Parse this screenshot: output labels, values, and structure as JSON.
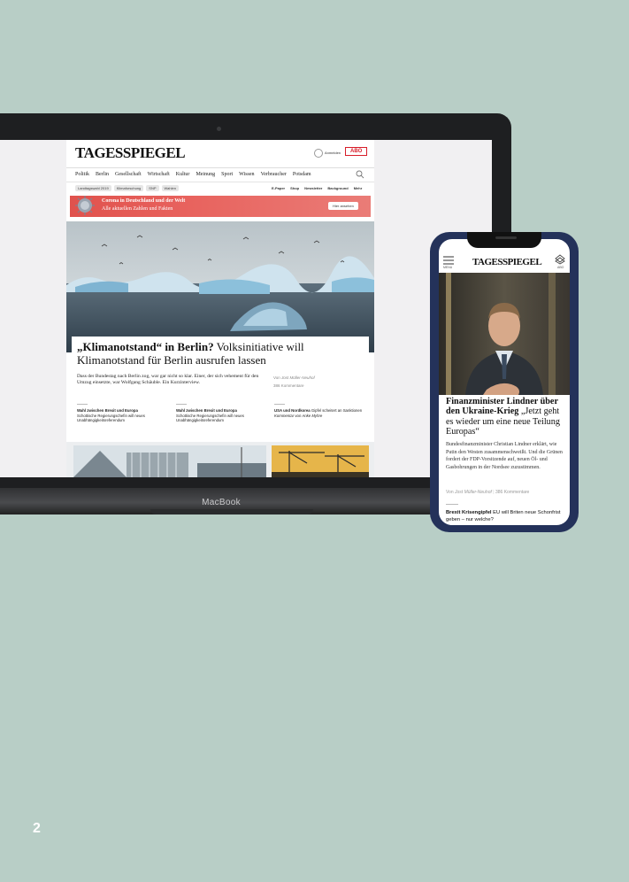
{
  "laptop": {
    "brand_label": "MacBook",
    "site": {
      "logo": "TAGESSPIEGEL",
      "login_label": "Anmelden",
      "abo_label": "ABO",
      "nav": [
        "Politik",
        "Berlin",
        "Gesellschaft",
        "Wirtschaft",
        "Kultur",
        "Meinung",
        "Sport",
        "Wissen",
        "Verbraucher",
        "Potsdam"
      ],
      "chips": [
        "Landtagswahl 2019",
        "Klimaforschung",
        "SNP",
        "Wahlen"
      ],
      "secondary_nav": [
        "E-Paper",
        "Shop",
        "Newsletter",
        "Background",
        "Mehr"
      ],
      "banner": {
        "line1": "Corona in Deutschland und der Welt",
        "line2": "Alle aktuellen Zahlen und Fakten",
        "button": "Hier ansehen"
      },
      "headline_bold": "„Klimanotstand“ in Berlin?",
      "headline_rest": " Volksinitiative will Klimanotstand für Berlin ausrufen lassen",
      "teaser": "Dass der Bundestag nach Berlin zog, war gar nicht so klar. Einer, der sich vehement für den Umzug einsetzte, war Wolfgang Schäuble. Ein Kurzinterview.",
      "author_prefix": "Von",
      "author": "Jost Müller-Neuhof",
      "comments": "386 Kommentare",
      "sub_articles": [
        {
          "title": "Wahl zwischen Brexit und Europa",
          "text": "Schottische Regierungschefin will neues Unabhängigkeitsreferendum"
        },
        {
          "title": "Wahl zwischen Brexit und Europa",
          "text": "Schottische Regierungschefin will neues Unabhängigkeitsreferendum"
        },
        {
          "title": "USA und Nordkorea",
          "title_rest": " Gipfel scheitert an Sanktionen",
          "text": "Kommentar von Anke Myhre"
        }
      ]
    }
  },
  "phone": {
    "menu_label": "MENU",
    "logo": "TAGESSPIEGEL",
    "abo_label": "ABO",
    "headline_bold": "Finanzminister Lindner über den Ukraine-Krieg",
    "headline_rest": " „Jetzt geht es wieder um eine neue Teilung Europas“",
    "teaser": "Bundesfinanzminister Christian Lindner erklärt, wie Putin den Westen zusammenschweißt. Und die Grünen fordert der FDP-Vorsitzende auf, neuen Öl- und Gasbohrungen in der Nordsee zuzustimmen.",
    "author_prefix": "Von",
    "author": "Jost Müller-Neuhof",
    "comments": "386 Kommentare",
    "next_bold": "Brexit Krisengipfel",
    "next_rest": " EU will Briten neue Schonfrist geben – nur welche?"
  },
  "page_number": "2",
  "colors": {
    "background": "#b8cec6",
    "brand_red": "#d81d2a",
    "phone_frame": "#24325a"
  }
}
